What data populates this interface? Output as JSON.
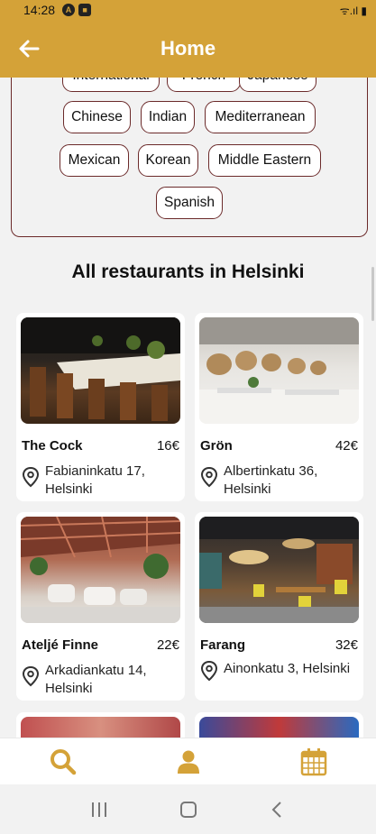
{
  "status_bar": {
    "time": "14:28",
    "app_icons": [
      "a-icon",
      "app-icon"
    ],
    "right_text": "ᯤ.ıl ▮"
  },
  "header": {
    "title": "Home"
  },
  "filters": {
    "cuisines": [
      "International",
      "French",
      "Japanese",
      "Chinese",
      "Indian",
      "Mediterranean",
      "Mexican",
      "Korean",
      "Middle Eastern",
      "Spanish"
    ]
  },
  "section": {
    "title": "All restaurants in Helsinki"
  },
  "restaurants": [
    {
      "name": "The Cock",
      "price": "16€",
      "address": "Fabianinkatu 17, Helsinki"
    },
    {
      "name": "Grön",
      "price": "42€",
      "address": "Albertinkatu 36, Helsinki"
    },
    {
      "name": "Ateljé Finne",
      "price": "22€",
      "address": "Arkadiankatu 14, Helsinki"
    },
    {
      "name": "Farang",
      "price": "32€",
      "address": "Ainonkatu 3, Helsinki"
    }
  ],
  "bottom_nav": [
    "search-icon",
    "profile-icon",
    "calendar-icon"
  ],
  "colors": {
    "accent": "#d4a238",
    "chip_border": "#6b2a2a"
  }
}
